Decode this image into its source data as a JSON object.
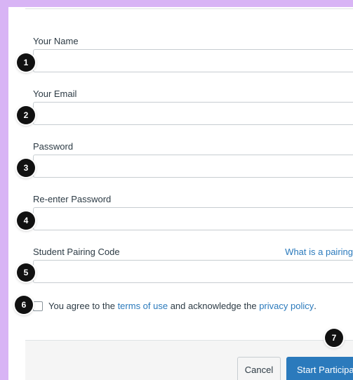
{
  "form": {
    "name_label": "Your Name",
    "email_label": "Your Email",
    "password_label": "Password",
    "reenter_label": "Re-enter Password",
    "pairing_label": "Student Pairing Code",
    "pairing_link": "What is a pairing",
    "agree_prefix": "You agree to the ",
    "terms_link": "terms of use",
    "agree_middle": " and acknowledge the ",
    "privacy_link": "privacy policy",
    "agree_suffix": "."
  },
  "footer": {
    "cancel_label": "Cancel",
    "start_label": "Start Participa"
  },
  "badges": [
    "1",
    "2",
    "3",
    "4",
    "5",
    "6",
    "7"
  ],
  "colors": {
    "background": "#d8b4f5",
    "accent": "#2b7abc",
    "text": "#2d3b45",
    "badge": "#111111"
  }
}
